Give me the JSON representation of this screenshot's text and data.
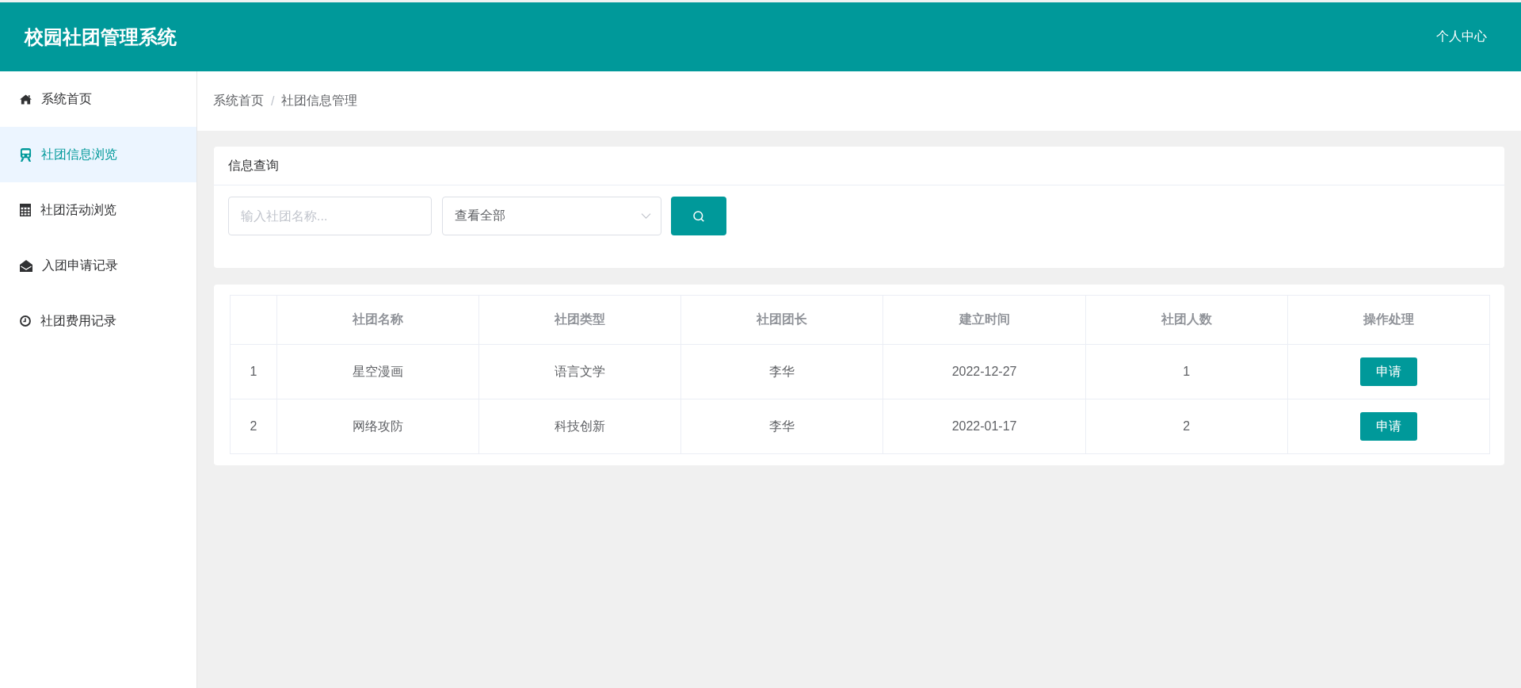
{
  "header": {
    "title": "校园社团管理系统",
    "user_link": "个人中心"
  },
  "sidebar": {
    "items": [
      {
        "label": "系统首页",
        "selected": false
      },
      {
        "label": "社团信息浏览",
        "selected": true
      },
      {
        "label": "社团活动浏览",
        "selected": false
      },
      {
        "label": "入团申请记录",
        "selected": false
      },
      {
        "label": "社团费用记录",
        "selected": false
      }
    ]
  },
  "breadcrumb": {
    "items": [
      "系统首页",
      "社团信息管理"
    ],
    "separator": "/"
  },
  "search_panel": {
    "title": "信息查询",
    "name_field": {
      "placeholder": "输入社团名称..."
    },
    "type_select": {
      "value": "查看全部"
    }
  },
  "table": {
    "columns": [
      "社团名称",
      "社团类型",
      "社团团长",
      "建立时间",
      "社团人数",
      "操作处理"
    ],
    "rows": [
      {
        "number": "1",
        "club_name": "星空漫画",
        "club_type": "语言文学",
        "leader": "李华",
        "founded": "2022-12-27",
        "members": "1",
        "action": "申请"
      },
      {
        "number": "2",
        "club_name": "网络攻防",
        "club_type": "科技创新",
        "leader": "李华",
        "founded": "2022-01-17",
        "members": "2",
        "action": "申请"
      }
    ]
  }
}
